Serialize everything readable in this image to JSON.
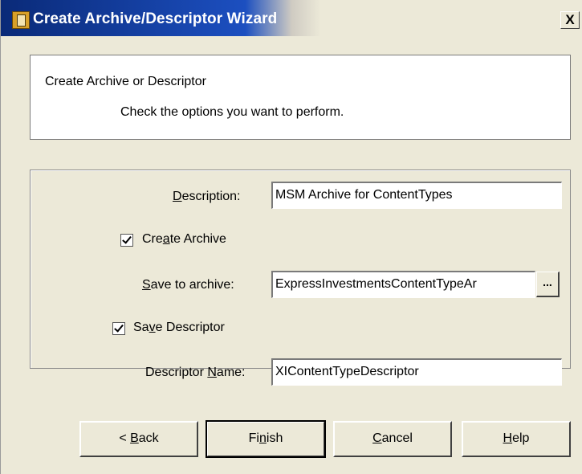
{
  "window": {
    "title": "Create Archive/Descriptor Wizard",
    "close_label": "X"
  },
  "header": {
    "title": "Create Archive or Descriptor",
    "subtitle": "Check the options you want to perform."
  },
  "form": {
    "description": {
      "label_pre": "",
      "label_u": "D",
      "label_post": "escription:",
      "value": "MSM Archive for ContentTypes"
    },
    "create_archive": {
      "label_pre": "Cre",
      "label_u": "a",
      "label_post": "te Archive",
      "checked": true
    },
    "save_to_archive": {
      "label_pre": "",
      "label_u": "S",
      "label_post": "ave to archive:",
      "value": "ExpressInvestmentsContentTypeAr",
      "browse_label": "..."
    },
    "save_descriptor": {
      "label_pre": "Sa",
      "label_u": "v",
      "label_post": "e Descriptor",
      "checked": true
    },
    "descriptor_name": {
      "label_pre": "Descriptor ",
      "label_u": "N",
      "label_post": "ame:",
      "value": "XIContentTypeDescriptor"
    }
  },
  "buttons": {
    "back": {
      "pre": "< ",
      "u": "B",
      "post": "ack"
    },
    "finish": {
      "pre": "Fi",
      "u": "n",
      "post": "ish"
    },
    "cancel": {
      "pre": "",
      "u": "C",
      "post": "ancel"
    },
    "help": {
      "pre": "",
      "u": "H",
      "post": "elp"
    }
  }
}
